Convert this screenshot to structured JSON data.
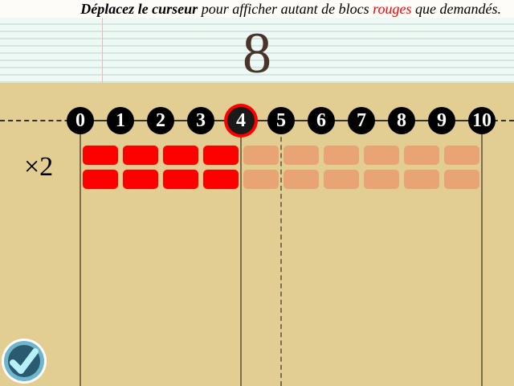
{
  "instruction": {
    "bold": "Déplacez le curseur",
    "part1": " pour afficher autant de blocs ",
    "red": "rouges",
    "part2": " que demandés."
  },
  "target": "8",
  "multiplier": "×2",
  "number_line": {
    "labels": [
      "0",
      "1",
      "2",
      "3",
      "4",
      "5",
      "6",
      "7",
      "8",
      "9",
      "10"
    ],
    "selected": 4
  },
  "blocks": {
    "rows": 2,
    "columns": 10,
    "red_columns": 4
  },
  "colors": {
    "red": "#ff0000",
    "inactive": "#e8a474",
    "background": "#e2cd92"
  },
  "submit_icon": "checkmark-icon"
}
